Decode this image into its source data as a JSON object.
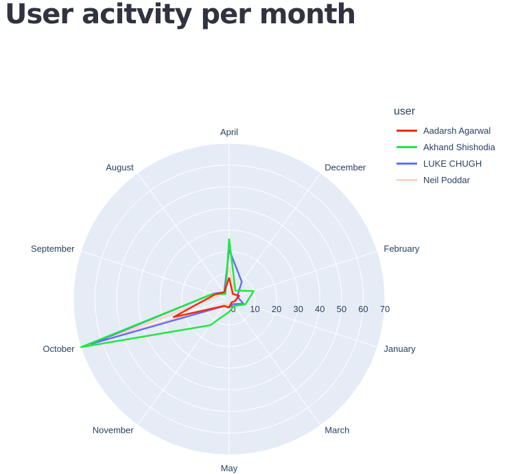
{
  "title": "User acitvity per month",
  "legend": {
    "title": "user"
  },
  "chart_data": {
    "type": "line-polar",
    "theta": [
      "April",
      "December",
      "February",
      "January",
      "March",
      "May",
      "November",
      "October",
      "September",
      "August"
    ],
    "radial_ticks": [
      "0",
      "10",
      "20",
      "30",
      "40",
      "50",
      "60",
      "70"
    ],
    "radial_range": [
      0,
      70
    ],
    "grid": true,
    "legend_position": "top-right",
    "series": [
      {
        "name": "Aadarsh Agarwal",
        "color": "#ef2b0a",
        "values": [
          8,
          1,
          3,
          1,
          0,
          2,
          2,
          25,
          5,
          2
        ]
      },
      {
        "name": "Akhand Shishodia",
        "color": "#1ee83f",
        "values": [
          26,
          3,
          10,
          6,
          2,
          4,
          13,
          70,
          6,
          1
        ]
      },
      {
        "name": "LUKE CHUGH",
        "color": "#636efa",
        "values": [
          21,
          8,
          2,
          5,
          1,
          2,
          2,
          65,
          6,
          2
        ]
      },
      {
        "name": "Neil Poddar",
        "color": "#f9d5c6",
        "values": [
          13,
          2,
          1,
          1,
          0,
          1,
          1,
          55,
          3,
          2
        ]
      }
    ]
  }
}
